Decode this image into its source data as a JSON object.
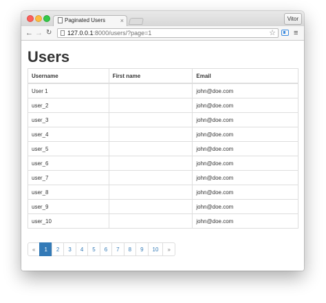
{
  "browser": {
    "tab_title": "Paginated Users",
    "tab_close": "×",
    "profile_name": "Vitor",
    "url_host": "127.0.0.1",
    "url_rest": ":8000/users/?page=1",
    "back_glyph": "←",
    "forward_glyph": "→",
    "reload_glyph": "↻",
    "star_glyph": "☆",
    "menu_glyph": "≡"
  },
  "page": {
    "title": "Users",
    "columns": [
      "Username",
      "First name",
      "Email"
    ],
    "rows": [
      {
        "username": "User 1",
        "first_name": "",
        "email": "john@doe.com"
      },
      {
        "username": "user_2",
        "first_name": "",
        "email": "john@doe.com"
      },
      {
        "username": "user_3",
        "first_name": "",
        "email": "john@doe.com"
      },
      {
        "username": "user_4",
        "first_name": "",
        "email": "john@doe.com"
      },
      {
        "username": "user_5",
        "first_name": "",
        "email": "john@doe.com"
      },
      {
        "username": "user_6",
        "first_name": "",
        "email": "john@doe.com"
      },
      {
        "username": "user_7",
        "first_name": "",
        "email": "john@doe.com"
      },
      {
        "username": "user_8",
        "first_name": "",
        "email": "john@doe.com"
      },
      {
        "username": "user_9",
        "first_name": "",
        "email": "john@doe.com"
      },
      {
        "username": "user_10",
        "first_name": "",
        "email": "john@doe.com"
      }
    ]
  },
  "pagination": {
    "prev": "«",
    "pages": [
      "1",
      "2",
      "3",
      "4",
      "5",
      "6",
      "7",
      "8",
      "9",
      "10"
    ],
    "active": "1",
    "next": "»"
  },
  "colors": {
    "link": "#337ab7",
    "active_page_bg": "#337ab7",
    "table_border": "#dddddd"
  }
}
